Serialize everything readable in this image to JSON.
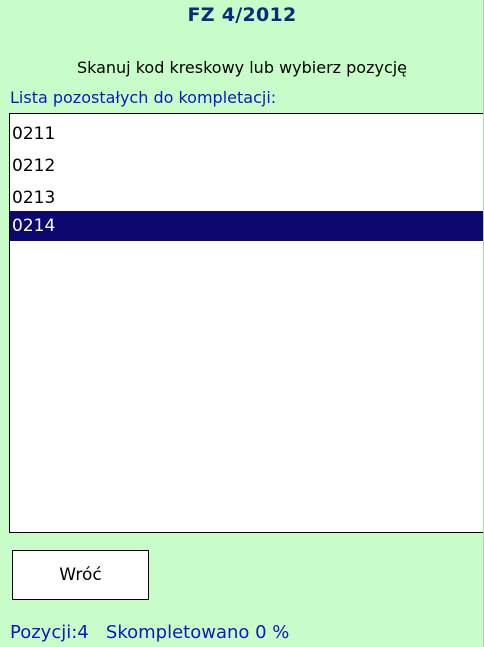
{
  "header": {
    "title": "FZ 4/2012",
    "instruction": "Skanuj kod kreskowy lub wybierz pozycję",
    "list_caption": "Lista pozostałych do kompletacji:"
  },
  "list": {
    "items": [
      {
        "label": "0211",
        "selected": false
      },
      {
        "label": "0212",
        "selected": false
      },
      {
        "label": "0213",
        "selected": false
      },
      {
        "label": "0214",
        "selected": true
      }
    ]
  },
  "footer": {
    "back_label": "Wróć",
    "status": "Pozycji:4   Skompletowano 0 %"
  },
  "colors": {
    "background": "#c8fcc8",
    "title": "#0a2c7a",
    "caption": "#1018b8",
    "selection": "#0c0870"
  }
}
